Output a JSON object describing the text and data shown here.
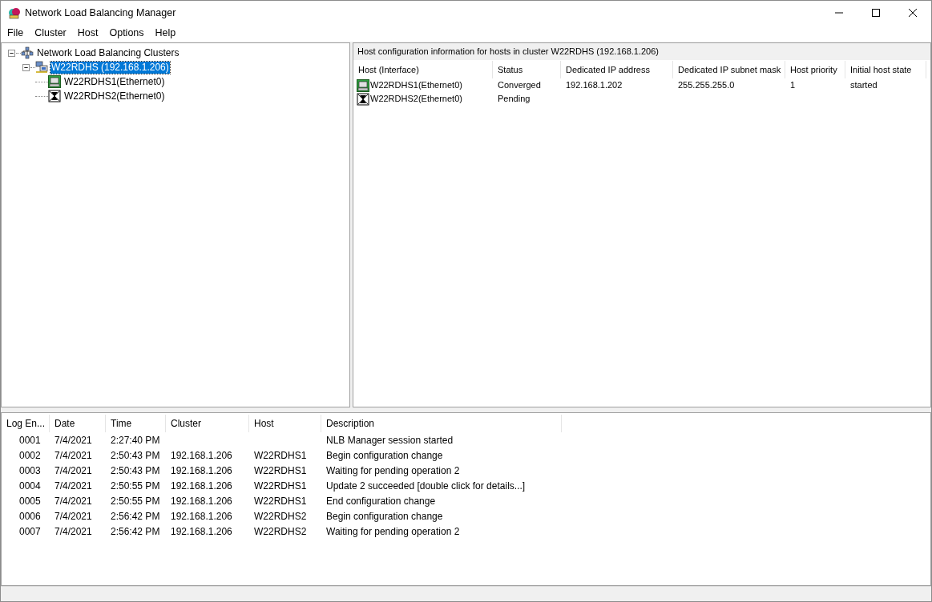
{
  "window": {
    "title": "Network Load Balancing Manager"
  },
  "menu": [
    "File",
    "Cluster",
    "Host",
    "Options",
    "Help"
  ],
  "tree": {
    "label": "Network Load Balancing Clusters",
    "expanded": true,
    "selected": false,
    "kind": "root",
    "children": [
      {
        "label": "W22RDHS (192.168.1.206)",
        "expanded": true,
        "selected": true,
        "kind": "cluster",
        "children": [
          {
            "label": "W22RDHS1(Ethernet0)",
            "selected": false,
            "kind": "converged"
          },
          {
            "label": "W22RDHS2(Ethernet0)",
            "selected": false,
            "kind": "pending"
          }
        ]
      }
    ]
  },
  "host_panel": {
    "caption": "Host configuration information for hosts in cluster W22RDHS (192.168.1.206)",
    "columns": [
      "Host (Interface)",
      "Status",
      "Dedicated IP address",
      "Dedicated IP subnet mask",
      "Host priority",
      "Initial host state"
    ],
    "rows": [
      {
        "kind": "converged",
        "cells": [
          "W22RDHS1(Ethernet0)",
          "Converged",
          "192.168.1.202",
          "255.255.255.0",
          "1",
          "started"
        ]
      },
      {
        "kind": "pending",
        "cells": [
          "W22RDHS2(Ethernet0)",
          "Pending"
        ]
      }
    ]
  },
  "log": {
    "columns": [
      "Log En...",
      "Date",
      "Time",
      "Cluster",
      "Host",
      "Description"
    ],
    "rows": [
      [
        "0001",
        "7/4/2021",
        "2:27:40 PM",
        "",
        "",
        "NLB Manager session started"
      ],
      [
        "0002",
        "7/4/2021",
        "2:50:43 PM",
        "192.168.1.206",
        "W22RDHS1",
        "Begin configuration change"
      ],
      [
        "0003",
        "7/4/2021",
        "2:50:43 PM",
        "192.168.1.206",
        "W22RDHS1",
        "Waiting for pending operation 2"
      ],
      [
        "0004",
        "7/4/2021",
        "2:50:55 PM",
        "192.168.1.206",
        "W22RDHS1",
        "Update 2 succeeded [double click for details...]"
      ],
      [
        "0005",
        "7/4/2021",
        "2:50:55 PM",
        "192.168.1.206",
        "W22RDHS1",
        "End configuration change"
      ],
      [
        "0006",
        "7/4/2021",
        "2:56:42 PM",
        "192.168.1.206",
        "W22RDHS2",
        "Begin configuration change"
      ],
      [
        "0007",
        "7/4/2021",
        "2:56:42 PM",
        "192.168.1.206",
        "W22RDHS2",
        "Waiting for pending operation 2"
      ]
    ]
  }
}
